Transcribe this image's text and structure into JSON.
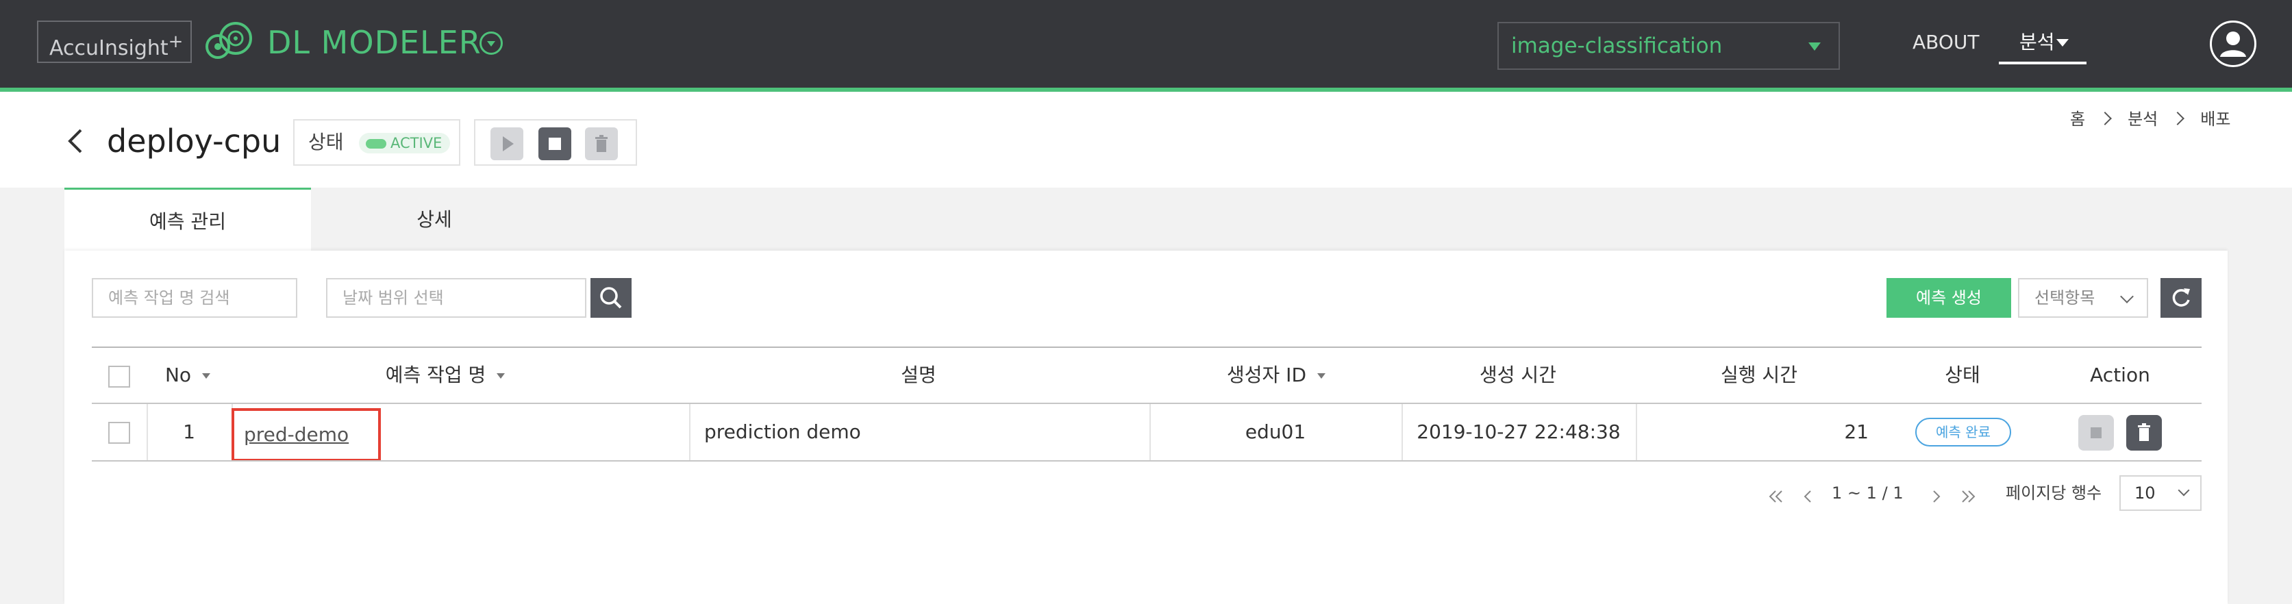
{
  "header": {
    "brand": "AccuInsight",
    "brand_suffix": "+",
    "product": "DL MODELER",
    "project": "image-classification",
    "nav": {
      "about": "ABOUT",
      "analysis": "분석"
    }
  },
  "page": {
    "title": "deploy-cpu",
    "status_label": "상태",
    "status_value": "ACTIVE",
    "breadcrumb": [
      "홈",
      "분석",
      "배포"
    ]
  },
  "tabs": [
    {
      "label": "예측 관리",
      "active": true
    },
    {
      "label": "상세",
      "active": false
    }
  ],
  "toolbar": {
    "search_placeholder": "예측 작업 명 검색",
    "date_placeholder": "날짜 범위 선택",
    "create_label": "예측 생성",
    "select_label": "선택항목"
  },
  "table": {
    "columns": {
      "no": "No",
      "name": "예측 작업 명",
      "desc": "설명",
      "creator": "생성자 ID",
      "created": "생성 시간",
      "runtime": "실행 시간",
      "status": "상태",
      "action": "Action"
    },
    "rows": [
      {
        "no": "1",
        "name": "pred-demo",
        "desc": "prediction demo",
        "creator": "edu01",
        "created": "2019-10-27 22:48:38",
        "runtime": "21",
        "status": "예측 완료"
      }
    ]
  },
  "pagination": {
    "range_start": "1",
    "range_end": "1",
    "total": "1",
    "rows_label": "페이지당 행수",
    "rows_per_page": "10"
  },
  "colors": {
    "accent": "#4ec17a",
    "header_bg": "#36373b",
    "link_highlight": "#e53f33",
    "status_done": "#4ba4e0"
  }
}
